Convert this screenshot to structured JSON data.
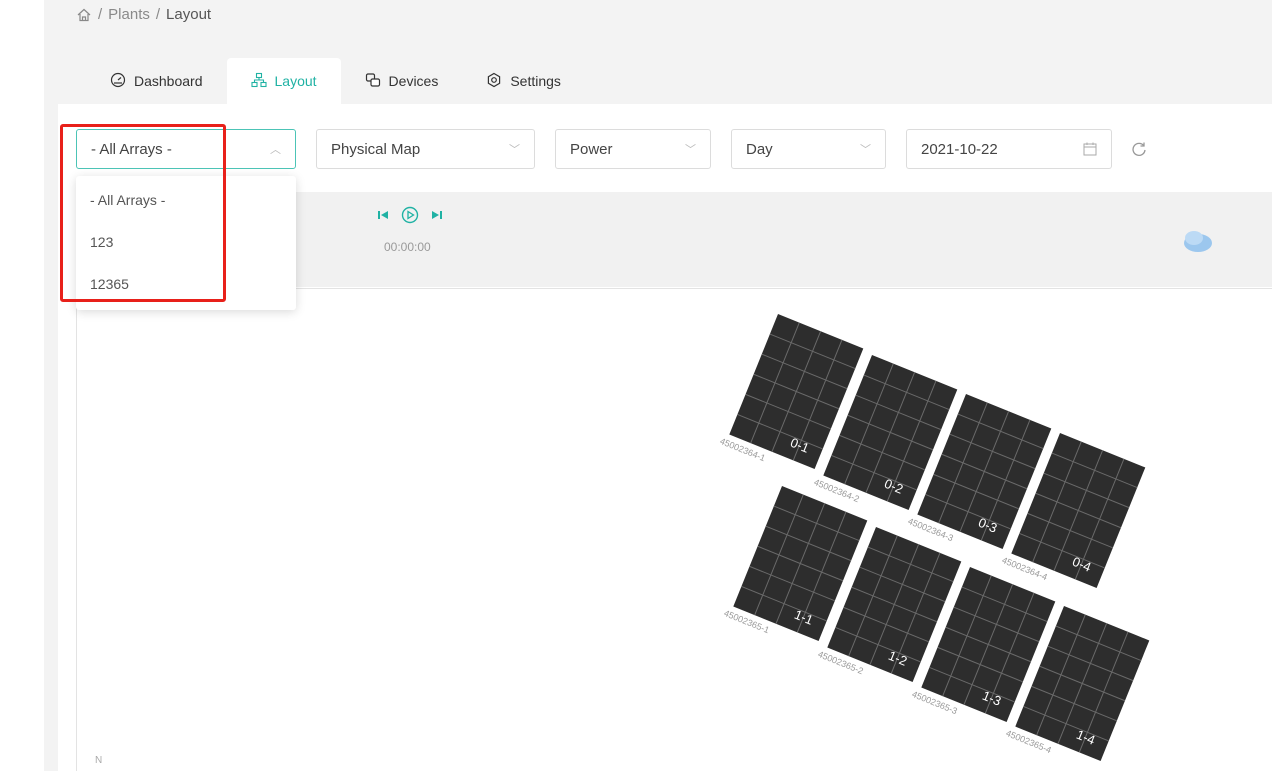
{
  "breadcrumb": {
    "home_icon": "home-icon",
    "plants": "Plants",
    "sep": "/",
    "current": "Layout"
  },
  "tabs": [
    {
      "label": "Dashboard",
      "icon": "dashboard-icon"
    },
    {
      "label": "Layout",
      "icon": "layout-icon",
      "active": true
    },
    {
      "label": "Devices",
      "icon": "devices-icon"
    },
    {
      "label": "Settings",
      "icon": "settings-icon"
    }
  ],
  "toolbar": {
    "arrays_value": "- All Arrays -",
    "map_value": "Physical Map",
    "metric_value": "Power",
    "period_value": "Day",
    "date_value": "2021-10-22"
  },
  "dropdown": {
    "options": [
      "- All Arrays -",
      "123",
      "12365"
    ]
  },
  "playback": {
    "time": "00:00:00"
  },
  "compass": "N",
  "colors": {
    "accent": "#20b2a4",
    "highlight": "#e8201a",
    "panel": "#2d2d2d"
  },
  "panels": [
    {
      "label": "0-1",
      "serial": "45002364-1"
    },
    {
      "label": "0-2",
      "serial": "45002364-2"
    },
    {
      "label": "0-3",
      "serial": "45002364-3"
    },
    {
      "label": "0-4",
      "serial": "45002364-4"
    },
    {
      "label": "1-1",
      "serial": "45002365-1"
    },
    {
      "label": "1-2",
      "serial": "45002365-2"
    },
    {
      "label": "1-3",
      "serial": "45002365-3"
    },
    {
      "label": "1-4",
      "serial": "45002365-4"
    }
  ]
}
